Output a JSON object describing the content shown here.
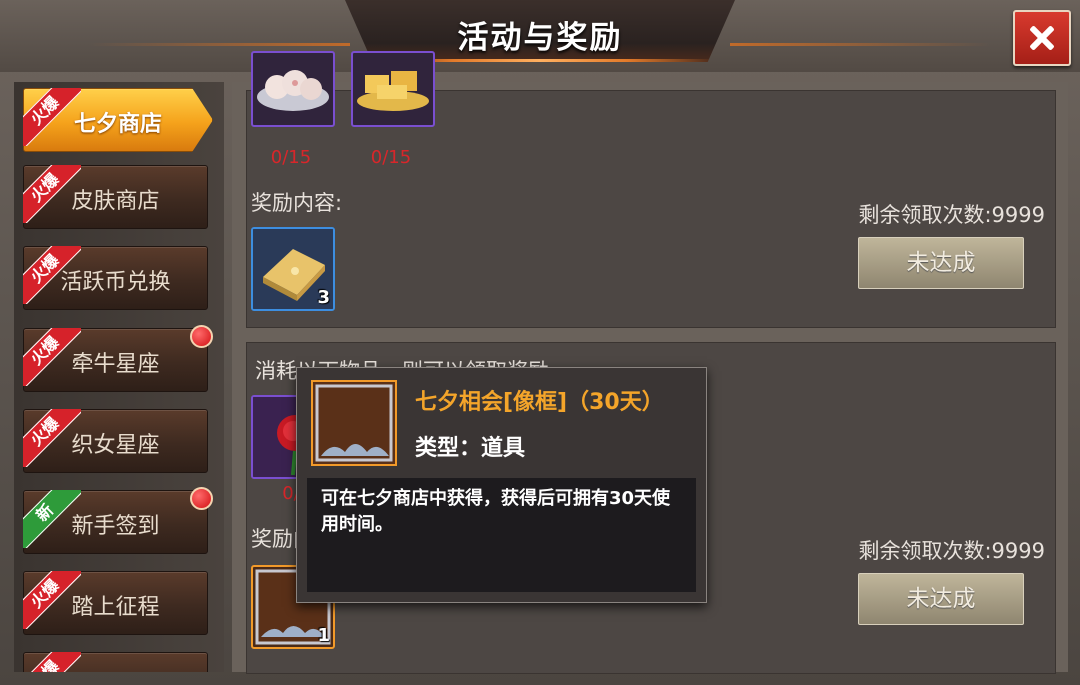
{
  "header": {
    "title": "活动与奖励"
  },
  "sidebar": {
    "items": [
      {
        "label": "七夕商店",
        "ribbon": "火爆",
        "active": true
      },
      {
        "label": "皮肤商店",
        "ribbon": "火爆"
      },
      {
        "label": "活跃币兑换",
        "ribbon": "火爆"
      },
      {
        "label": "牵牛星座",
        "ribbon": "火爆",
        "dot": true
      },
      {
        "label": "织女星座",
        "ribbon": "火爆"
      },
      {
        "label": "新手签到",
        "ribbon": "新",
        "dot": true
      },
      {
        "label": "踏上征程",
        "ribbon": "火爆"
      },
      {
        "label": "",
        "ribbon": "火爆"
      }
    ]
  },
  "panel1": {
    "consume_counts": [
      "0/15",
      "0/15"
    ],
    "reward_label": "奖励内容:",
    "reward_qty": "3",
    "remain_text": "剩余领取次数:9999",
    "button": "未达成"
  },
  "panel2": {
    "consume_label": "消耗以下物品，则可以领取奖励",
    "consume_count": "0/",
    "reward_label": "奖励内容:",
    "reward_qty": "1",
    "remain_text": "剩余领取次数:9999",
    "button": "未达成"
  },
  "tooltip": {
    "title": "七夕相会[像框]（30天）",
    "type": "类型：道具",
    "description": "可在七夕商店中获得，获得后可拥有30天使用时间。"
  },
  "colors": {
    "accent": "#f5a21b",
    "ribbon_hot": "#d6222a",
    "ribbon_new": "#2e9b3a",
    "count": "#d8262a"
  }
}
